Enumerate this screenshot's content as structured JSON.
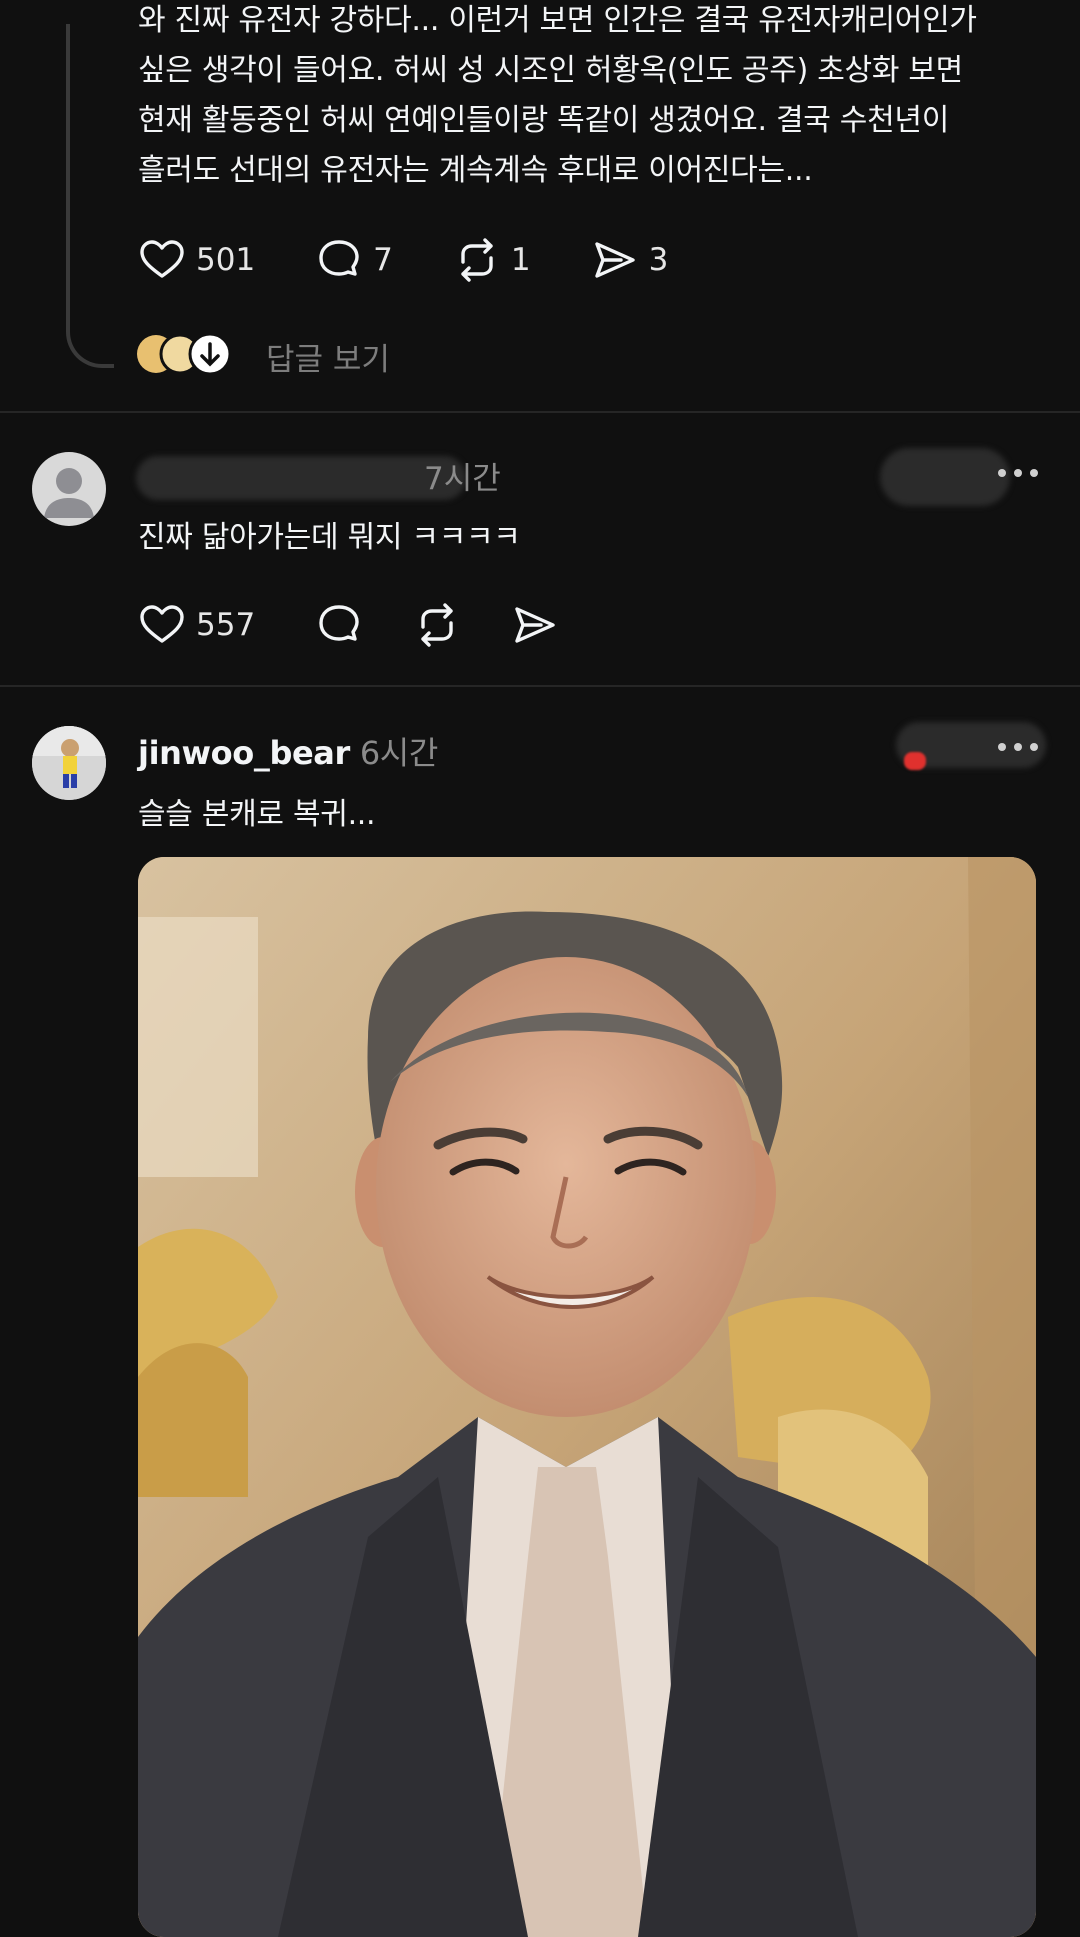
{
  "comment_1": {
    "text_lines": [
      "와 진짜 유전자 강하다... 이런거 보면 인간은 결국 유전자캐리어인가",
      "싶은 생각이 들어요. 허씨 성 시조인 허황옥(인도 공주) 초상화 보면",
      "현재 활동중인 허씨 연예인들이랑 똑같이 생겼어요. 결국 수천년이",
      "흘러도 선대의 유전자는 계속계속 후대로 이어진다는..."
    ],
    "likes": "501",
    "replies": "7",
    "reposts": "1",
    "shares": "3",
    "view_replies_label": "답글 보기"
  },
  "comment_2": {
    "time": "7시간",
    "text": "진짜 닮아가는데 뭐지 ㅋㅋㅋㅋ",
    "likes": "557"
  },
  "post_3": {
    "username": "jinwoo_bear",
    "time": "6시간",
    "text": "슬슬 본캐로 복귀..."
  },
  "icons": {
    "like": "heart-icon",
    "reply": "comment-bubble-icon",
    "repost": "repost-icon",
    "share": "send-icon",
    "more": "ellipsis-icon"
  }
}
